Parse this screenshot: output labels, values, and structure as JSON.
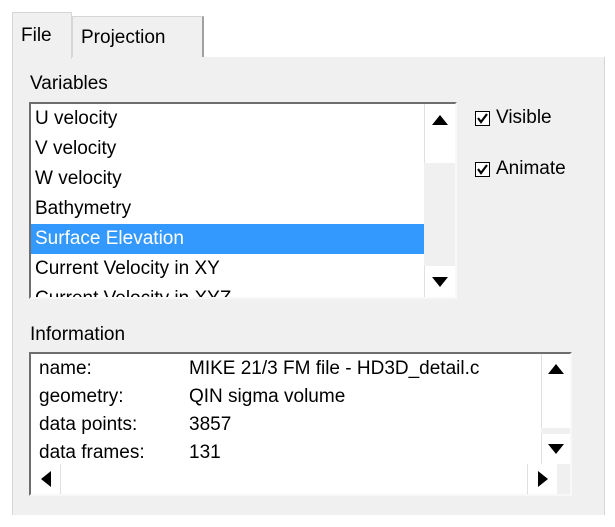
{
  "tabs": [
    {
      "label": "File",
      "active": true
    },
    {
      "label": "Projection",
      "active": false
    }
  ],
  "variables": {
    "heading": "Variables",
    "items": [
      "U velocity",
      "V velocity",
      "W velocity",
      "Bathymetry",
      "Surface Elevation",
      "Current Velocity in XY",
      "Current Velocity in XYZ"
    ],
    "selected_index": 4,
    "selection_color": "#3399ff"
  },
  "options": {
    "visible_label": "Visible",
    "visible_checked": true,
    "animate_label": "Animate",
    "animate_checked": true
  },
  "information": {
    "heading": "Information",
    "rows": [
      {
        "key": "name:",
        "value": "MIKE 21/3 FM file - HD3D_detail.c"
      },
      {
        "key": "geometry:",
        "value": "QIN sigma volume"
      },
      {
        "key": "data points:",
        "value": "3857"
      },
      {
        "key": "data frames:",
        "value": "131"
      }
    ]
  },
  "icons": {
    "scroll_up": "scroll-up-arrow-icon",
    "scroll_down": "scroll-down-arrow-icon",
    "scroll_left": "scroll-left-arrow-icon",
    "scroll_right": "scroll-right-arrow-icon",
    "checkmark": "checkmark-icon"
  }
}
